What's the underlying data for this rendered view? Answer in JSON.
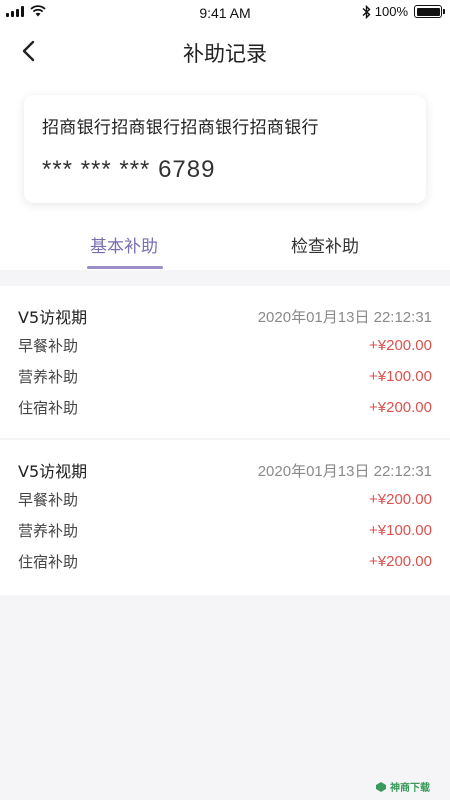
{
  "status_bar": {
    "time": "9:41 AM",
    "battery": "100%",
    "battery_level": 1.0
  },
  "nav": {
    "title": "补助记录"
  },
  "card": {
    "bank_name": "招商银行招商银行招商银行招商银行",
    "number": "*** *** *** 6789"
  },
  "tabs": [
    {
      "label": "基本补助",
      "active": true
    },
    {
      "label": "检查补助",
      "active": false
    }
  ],
  "records": [
    {
      "title": "V5访视期",
      "time": "2020年01月13日  22:12:31",
      "items": [
        {
          "label": "早餐补助",
          "amount": "+¥200.00"
        },
        {
          "label": "营养补助",
          "amount": "+¥100.00"
        },
        {
          "label": "住宿补助",
          "amount": "+¥200.00"
        }
      ]
    },
    {
      "title": "V5访视期",
      "time": "2020年01月13日  22:12:31",
      "items": [
        {
          "label": "早餐补助",
          "amount": "+¥200.00"
        },
        {
          "label": "营养补助",
          "amount": "+¥100.00"
        },
        {
          "label": "住宿补助",
          "amount": "+¥200.00"
        }
      ]
    }
  ],
  "colors": {
    "accent": "#7a6fb3",
    "amount": "#d9534f",
    "background": "#f5f5f7"
  },
  "watermark": {
    "text": "神商下载"
  }
}
